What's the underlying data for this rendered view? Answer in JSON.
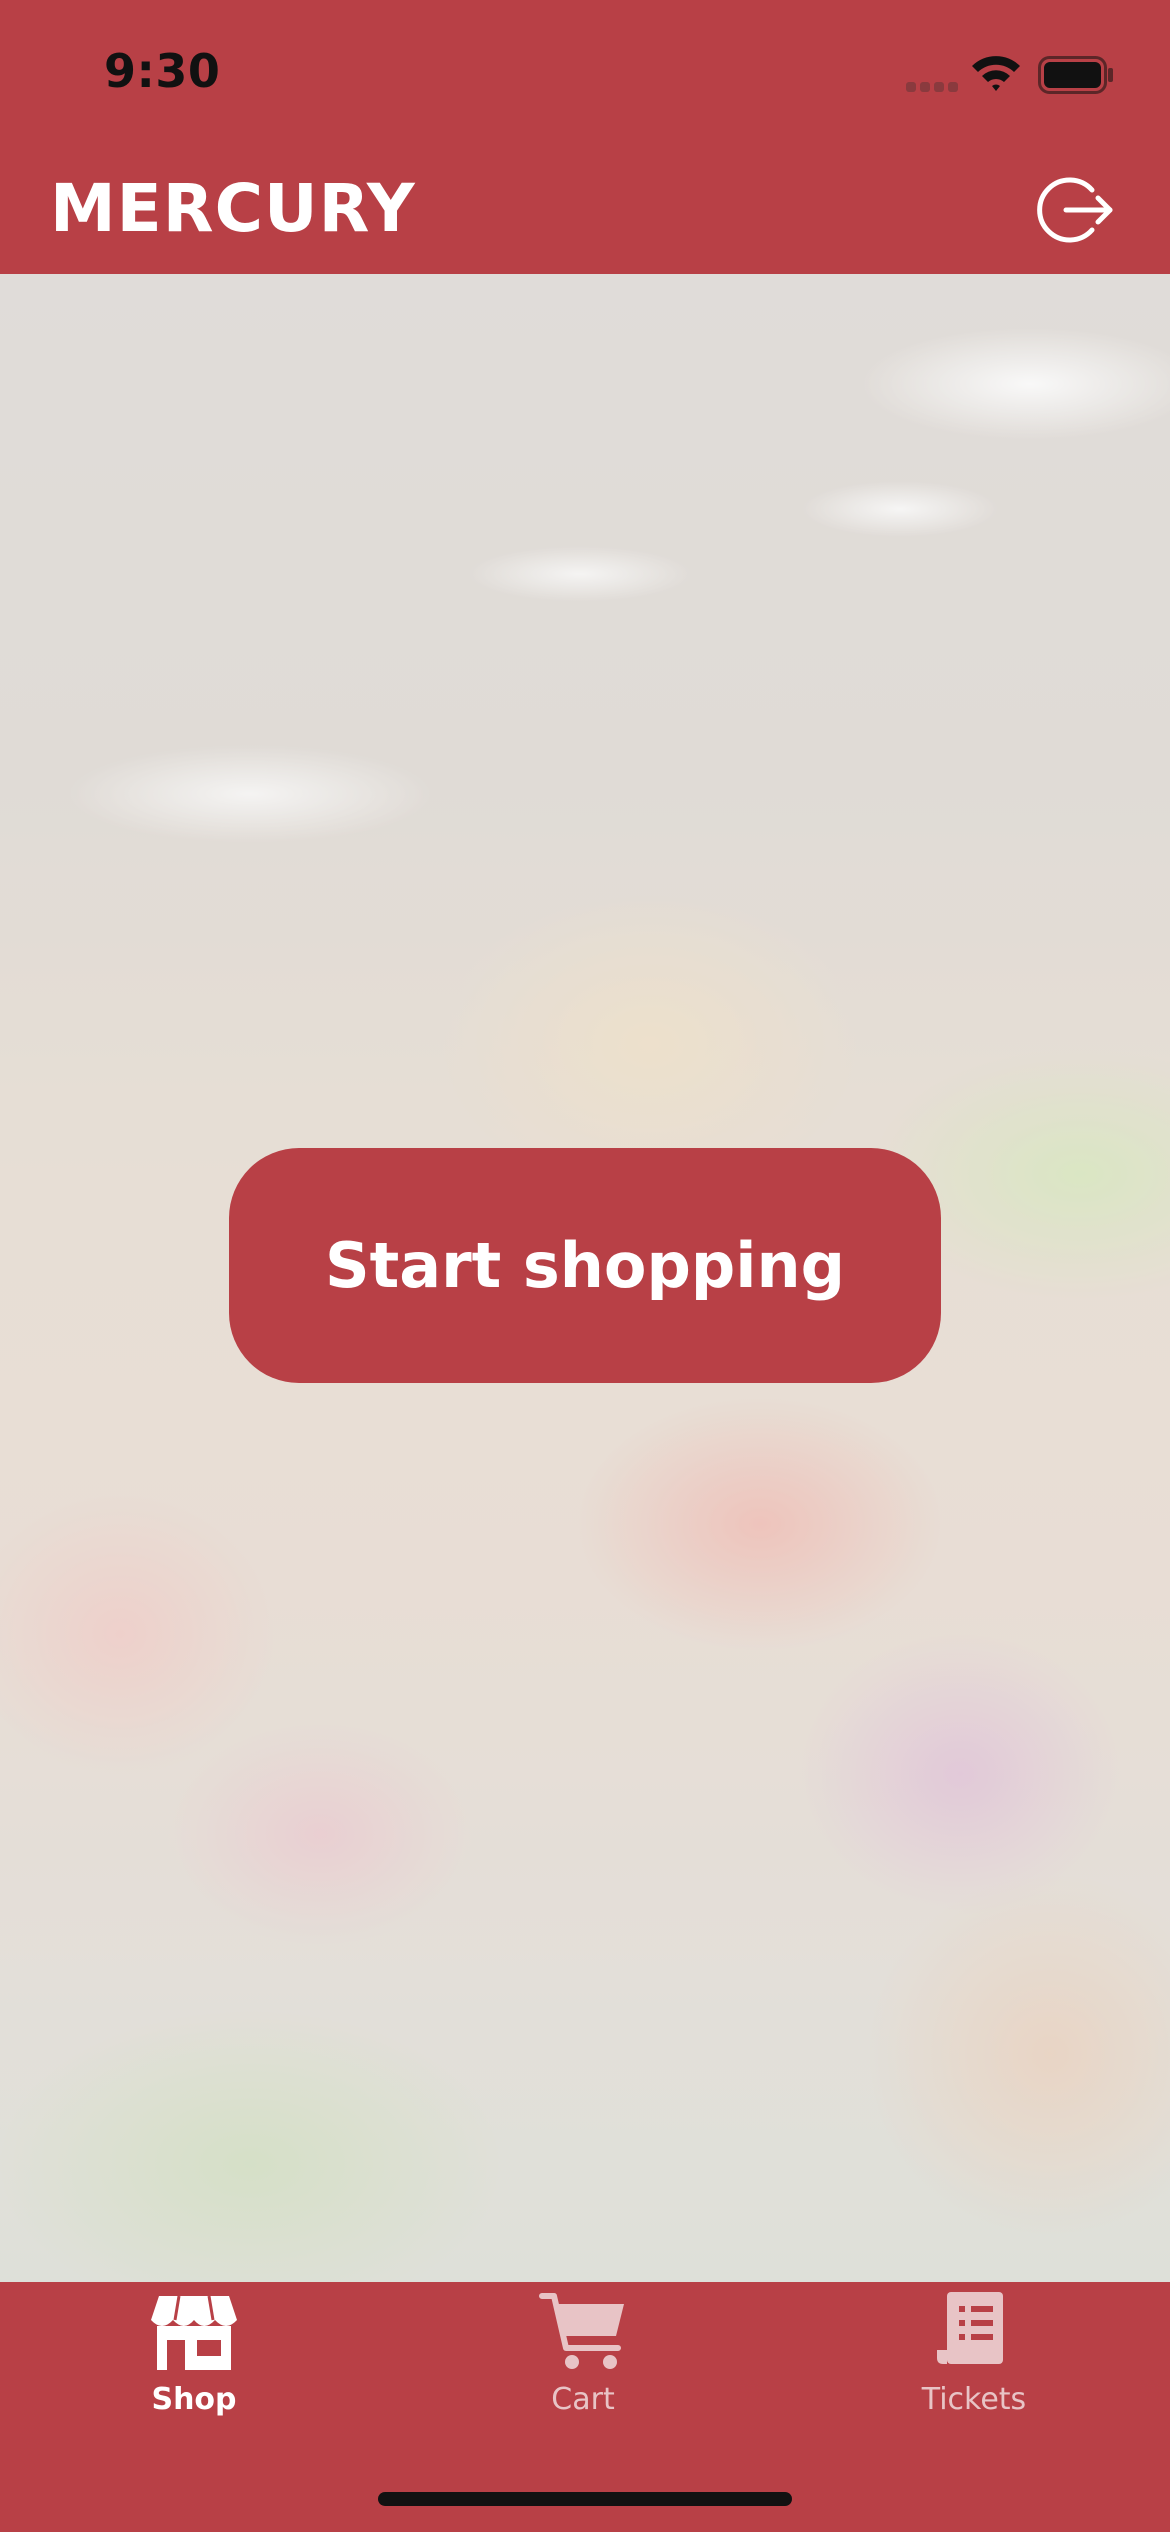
{
  "status_bar": {
    "time": "9:30"
  },
  "header": {
    "title": "MERCURY",
    "logout_icon": "logout-arrow-icon"
  },
  "hero": {
    "background": "blurred-produce-market-photo",
    "cta_label": "Start shopping"
  },
  "tab_bar": {
    "active": "Shop",
    "tabs": [
      {
        "label": "Shop",
        "icon": "storefront-icon"
      },
      {
        "label": "Cart",
        "icon": "cart-icon"
      },
      {
        "label": "Tickets",
        "icon": "receipt-icon"
      }
    ]
  },
  "colors": {
    "brand": "#b84046",
    "text_on_brand": "#ffffff",
    "inactive_tab": "#e8c4c6"
  }
}
